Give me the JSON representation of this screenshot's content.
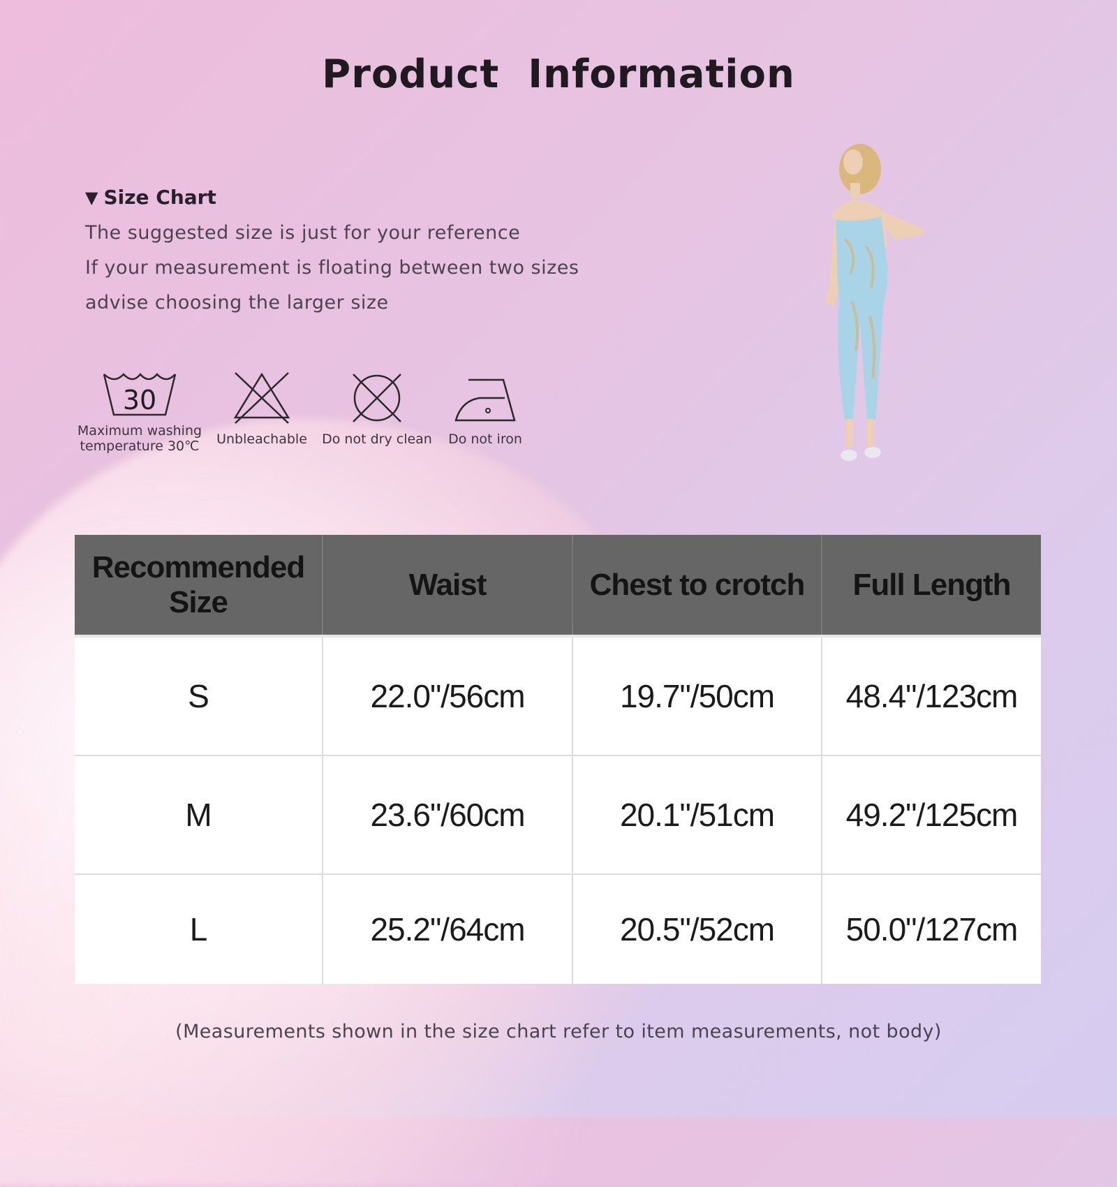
{
  "title": "Product  Information",
  "size_chart": {
    "heading": "Size Chart",
    "triangle_icon": "▼",
    "notes": [
      "The suggested size is just for your reference",
      "If your measurement is floating between two sizes",
      "advise choosing the larger size"
    ]
  },
  "care": {
    "wash": {
      "number": "30",
      "label_line1": "Maximum washing",
      "label_line2": "temperature 30℃"
    },
    "bleach": {
      "label": "Unbleachable"
    },
    "dryclean": {
      "label": "Do not dry clean"
    },
    "iron": {
      "label": "Do not iron"
    }
  },
  "table": {
    "headers": [
      "Recommended Size",
      "Waist",
      "Chest to crotch",
      "Full Length"
    ],
    "rows": [
      [
        "S",
        "22.0\"/56cm",
        "19.7\"/50cm",
        "48.4\"/123cm"
      ],
      [
        "M",
        "23.6\"/60cm",
        "20.1\"/51cm",
        "49.2\"/125cm"
      ],
      [
        "L",
        "25.2\"/64cm",
        "20.5\"/52cm",
        "50.0\"/127cm"
      ]
    ]
  },
  "footnote": "(Measurements shown in the size chart refer to item measurements, not body)",
  "colors": {
    "header_bg": "#666666",
    "cell_bg": "#ffffff",
    "outfit": "#a9d3e6"
  }
}
